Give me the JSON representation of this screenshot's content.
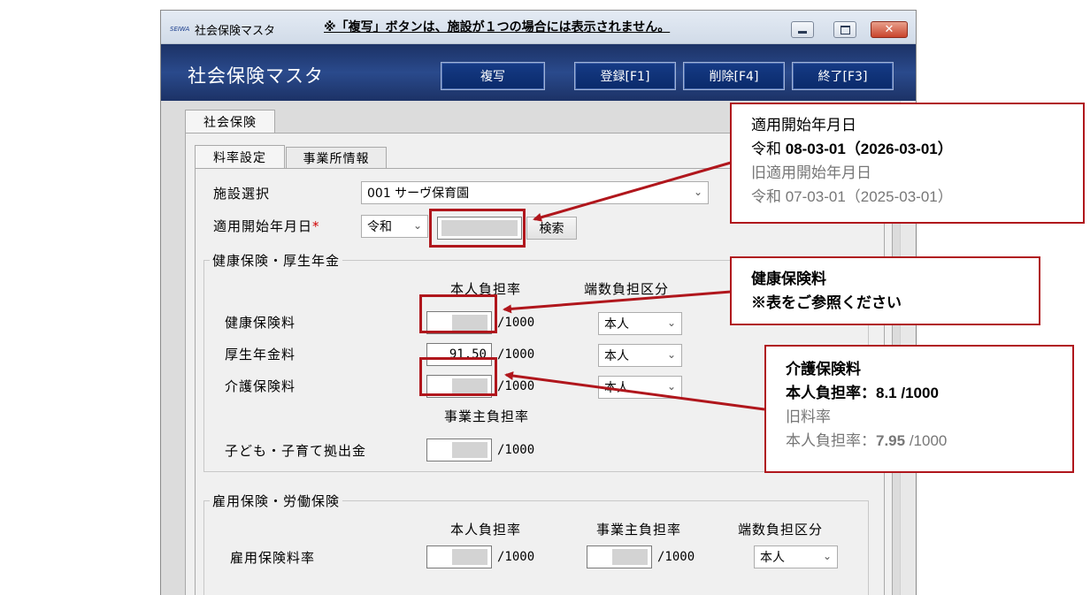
{
  "window": {
    "app_icon": "SEIWA",
    "title": "社会保険マスタ",
    "notice": "※「複写」ボタンは、施設が１つの場合には表示されません。",
    "controls": {
      "minimize": "minimize-icon",
      "maximize": "maximize-icon",
      "close": "✕"
    }
  },
  "header": {
    "title": "社会保険マスタ",
    "buttons": {
      "copy": "複写",
      "register": "登録[F1]",
      "delete": "削除[F4]",
      "exit": "終了[F3]"
    }
  },
  "tabs": {
    "outer": "社会保険",
    "inner": [
      "料率設定",
      "事業所情報"
    ]
  },
  "form": {
    "facility_label": "施設選択",
    "facility_value": "001 サーヴ保育園",
    "start_date_label": "適用開始年月日",
    "required_mark": "*",
    "era_value": "令和",
    "search_button": "検索",
    "health_group": {
      "title": "健康保険・厚生年金",
      "col_rate": "本人負担率",
      "col_rounding": "端数負担区分",
      "rows": [
        {
          "label": "健康保険料",
          "value": "",
          "unit": "/1000",
          "rounding": "本人"
        },
        {
          "label": "厚生年金料",
          "value": "91.50",
          "unit": "/1000",
          "rounding": "本人"
        },
        {
          "label": "介護保険料",
          "value": "",
          "unit": "/1000",
          "rounding": "本人"
        }
      ],
      "employer_rate_header": "事業主負担率",
      "child_label": "子ども・子育て拠出金",
      "child_unit": "/1000"
    },
    "employment_group": {
      "title": "雇用保険・労働保険",
      "col_rate": "本人負担率",
      "col_employer": "事業主負担率",
      "col_rounding": "端数負担区分",
      "row_label": "雇用保険料率",
      "unit": "/1000",
      "employer_unit": "/1000",
      "rounding": "本人"
    }
  },
  "callouts": {
    "date": {
      "line1": "適用開始年月日",
      "line2_prefix": "令和 ",
      "line2_bold": "08-03-01（2026-03-01）",
      "line3": "旧適用開始年月日",
      "line4": "令和 07-03-01（2025-03-01）"
    },
    "health": {
      "line1": "健康保険料",
      "line2": "※表をご参照ください"
    },
    "care": {
      "line1": "介護保険料",
      "line2_prefix": "本人負担率：",
      "line2_bold": "8.1 /1000",
      "line3": "旧料率",
      "line4_prefix": "本人負担率：",
      "line4_bold": "7.95",
      "line4_suffix": " /1000"
    }
  },
  "colors": {
    "header": "#1c3266",
    "callout_border": "#b0161c",
    "button": "#0a2a6a"
  }
}
